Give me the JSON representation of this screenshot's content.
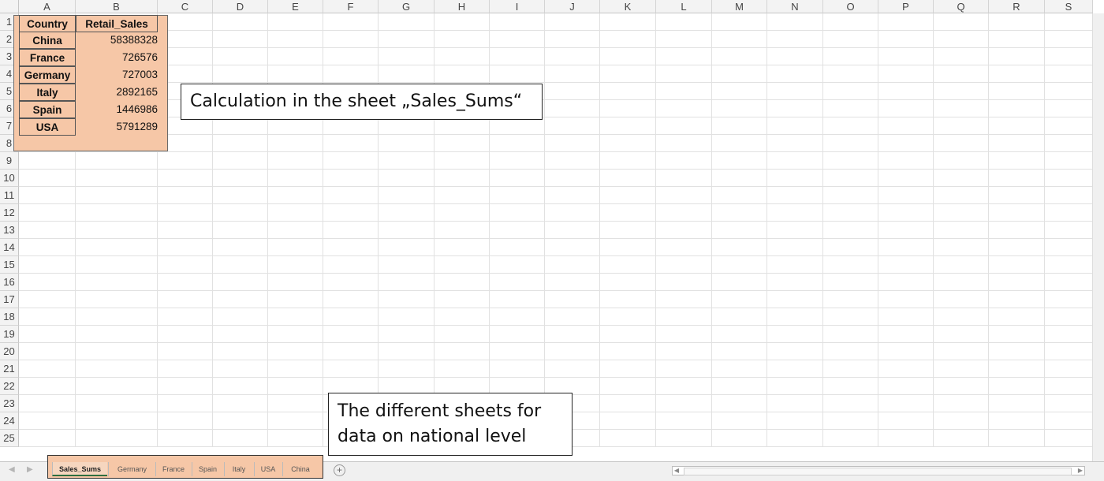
{
  "columns": [
    "A",
    "B",
    "C",
    "D",
    "E",
    "F",
    "G",
    "H",
    "I",
    "J",
    "K",
    "L",
    "M",
    "N",
    "O",
    "P",
    "Q",
    "R",
    "S"
  ],
  "rows": [
    "1",
    "2",
    "3",
    "4",
    "5",
    "6",
    "7",
    "8",
    "9",
    "10",
    "11",
    "12",
    "13",
    "14",
    "15",
    "16",
    "17",
    "18",
    "19",
    "20",
    "21",
    "22",
    "23",
    "24",
    "25"
  ],
  "table": {
    "headers": [
      "Country",
      "Retail_Sales"
    ],
    "rows": [
      {
        "country": "China",
        "sales": "58388328"
      },
      {
        "country": "France",
        "sales": "726576"
      },
      {
        "country": "Germany",
        "sales": "727003"
      },
      {
        "country": "Italy",
        "sales": "2892165"
      },
      {
        "country": "Spain",
        "sales": "1446986"
      },
      {
        "country": "USA",
        "sales": "5791289"
      }
    ]
  },
  "callouts": {
    "calculation": "Calculation in the sheet „Sales_Sums“",
    "sheets_line1": "The different sheets for",
    "sheets_line2": "data on national level"
  },
  "sheet_tabs": [
    "Sales_Sums",
    "Germany",
    "France",
    "Spain",
    "Italy",
    "USA",
    "China"
  ],
  "active_tab": "Sales_Sums",
  "add_sheet_icon": "+",
  "colors": {
    "highlight": "#f6c7a7",
    "active_tab_underline": "#2f6f3f"
  }
}
